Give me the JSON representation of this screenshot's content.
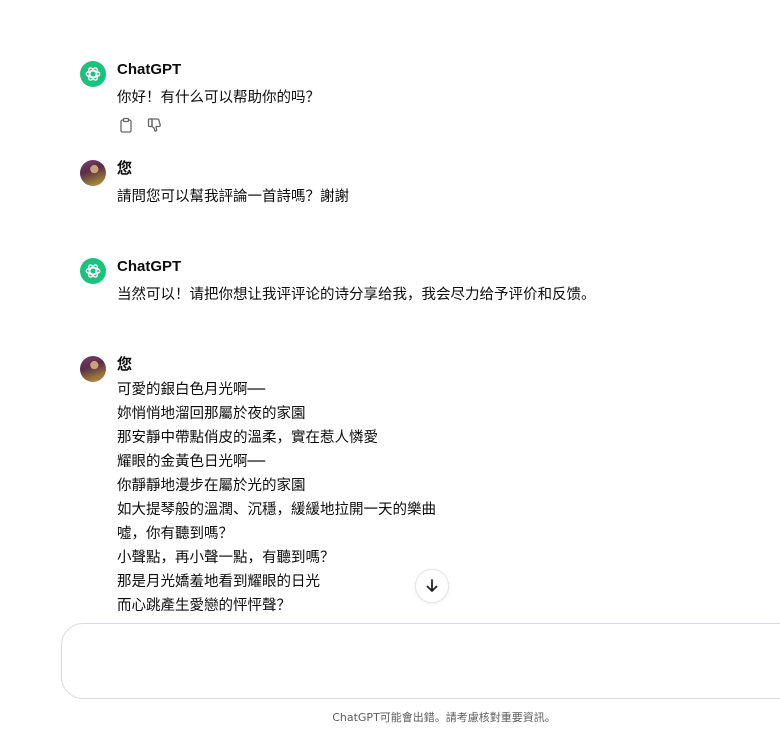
{
  "messages": [
    {
      "role": "assistant",
      "sender": "ChatGPT",
      "lines": [
        "你好！有什么可以帮助你的吗？"
      ],
      "actions": [
        "copy-icon",
        "thumbs-down-icon"
      ]
    },
    {
      "role": "user",
      "sender": "您",
      "lines": [
        "請問您可以幫我評論一首詩嗎？謝謝"
      ]
    },
    {
      "role": "assistant",
      "sender": "ChatGPT",
      "lines": [
        "当然可以！请把你想让我评评论的诗分享给我，我会尽力给予评价和反馈。"
      ]
    },
    {
      "role": "user",
      "sender": "您",
      "lines": [
        "可愛的銀白色月光啊──",
        "妳悄悄地溜回那屬於夜的家園",
        "那安靜中帶點俏皮的溫柔，實在惹人憐愛",
        "耀眼的金黃色日光啊──",
        "你靜靜地漫步在屬於光的家園",
        "如大提琴般的溫潤、沉穩，緩緩地拉開一天的樂曲",
        "噓，你有聽到嗎？",
        "小聲點，再小聲一點，有聽到嗎？",
        "那是月光嬌羞地看到耀眼的日光",
        "而心跳產生愛戀的怦怦聲？"
      ]
    }
  ],
  "composer": {
    "placeholder": ""
  },
  "footer": {
    "disclaimer": "ChatGPT可能會出錯。請考慮核對重要資訊。"
  },
  "colors": {
    "brand": "#19c37d",
    "text": "#0d0d0d",
    "muted": "#5d5d5d"
  }
}
